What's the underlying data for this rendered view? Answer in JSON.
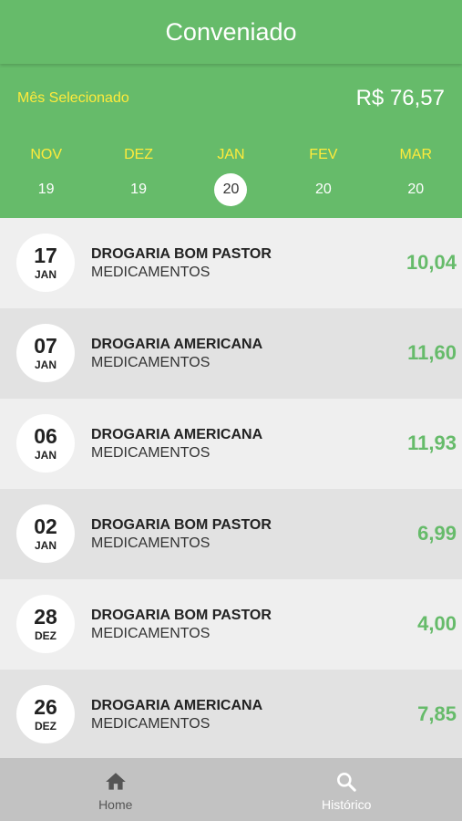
{
  "header": {
    "title": "Conveniado"
  },
  "summary": {
    "label": "Mês Selecionado",
    "total": "R$ 76,57"
  },
  "months": [
    {
      "name": "NOV",
      "year": "19",
      "selected": false
    },
    {
      "name": "DEZ",
      "year": "19",
      "selected": false
    },
    {
      "name": "JAN",
      "year": "20",
      "selected": true
    },
    {
      "name": "FEV",
      "year": "20",
      "selected": false
    },
    {
      "name": "MAR",
      "year": "20",
      "selected": false
    }
  ],
  "transactions": [
    {
      "day": "17",
      "month": "JAN",
      "merchant": "DROGARIA BOM PASTOR",
      "category": "MEDICAMENTOS",
      "amount": "10,04"
    },
    {
      "day": "07",
      "month": "JAN",
      "merchant": "DROGARIA AMERICANA",
      "category": "MEDICAMENTOS",
      "amount": "11,60"
    },
    {
      "day": "06",
      "month": "JAN",
      "merchant": "DROGARIA AMERICANA",
      "category": "MEDICAMENTOS",
      "amount": "11,93"
    },
    {
      "day": "02",
      "month": "JAN",
      "merchant": "DROGARIA BOM PASTOR",
      "category": "MEDICAMENTOS",
      "amount": "6,99"
    },
    {
      "day": "28",
      "month": "DEZ",
      "merchant": "DROGARIA BOM PASTOR",
      "category": "MEDICAMENTOS",
      "amount": "4,00"
    },
    {
      "day": "26",
      "month": "DEZ",
      "merchant": "DROGARIA AMERICANA",
      "category": "MEDICAMENTOS",
      "amount": "7,85"
    }
  ],
  "tabbar": {
    "tabs": [
      {
        "label": "Home",
        "icon": "home-icon",
        "active": false
      },
      {
        "label": "Histórico",
        "icon": "search-icon",
        "active": true
      }
    ]
  },
  "colors": {
    "brand_green": "#66bb6a",
    "accent_yellow": "#ffeb3b",
    "amount_green": "#66bb6a"
  }
}
